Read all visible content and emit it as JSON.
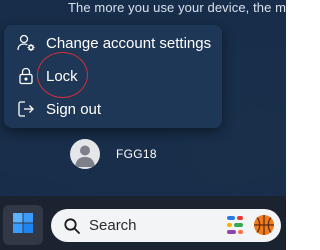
{
  "start_panel": {
    "hint_text": "The more you use your device, the mo"
  },
  "account_menu": {
    "items": [
      {
        "label": "Change account settings",
        "icon": "user-settings-icon"
      },
      {
        "label": "Lock",
        "icon": "lock-icon"
      },
      {
        "label": "Sign out",
        "icon": "sign-out-icon"
      }
    ]
  },
  "user": {
    "name": "FGG18",
    "icon": "avatar-icon"
  },
  "taskbar": {
    "start_icon": "windows-icon",
    "search": {
      "placeholder": "Search",
      "icon": "search-icon"
    },
    "search_highlights": [
      "widget-icon",
      "basketball-icon"
    ]
  },
  "colors": {
    "panel_bg": "#162c4c",
    "menu_bg": "#1f3756",
    "annotation": "#d0303a",
    "windows_blue": "#3aa0ff"
  }
}
